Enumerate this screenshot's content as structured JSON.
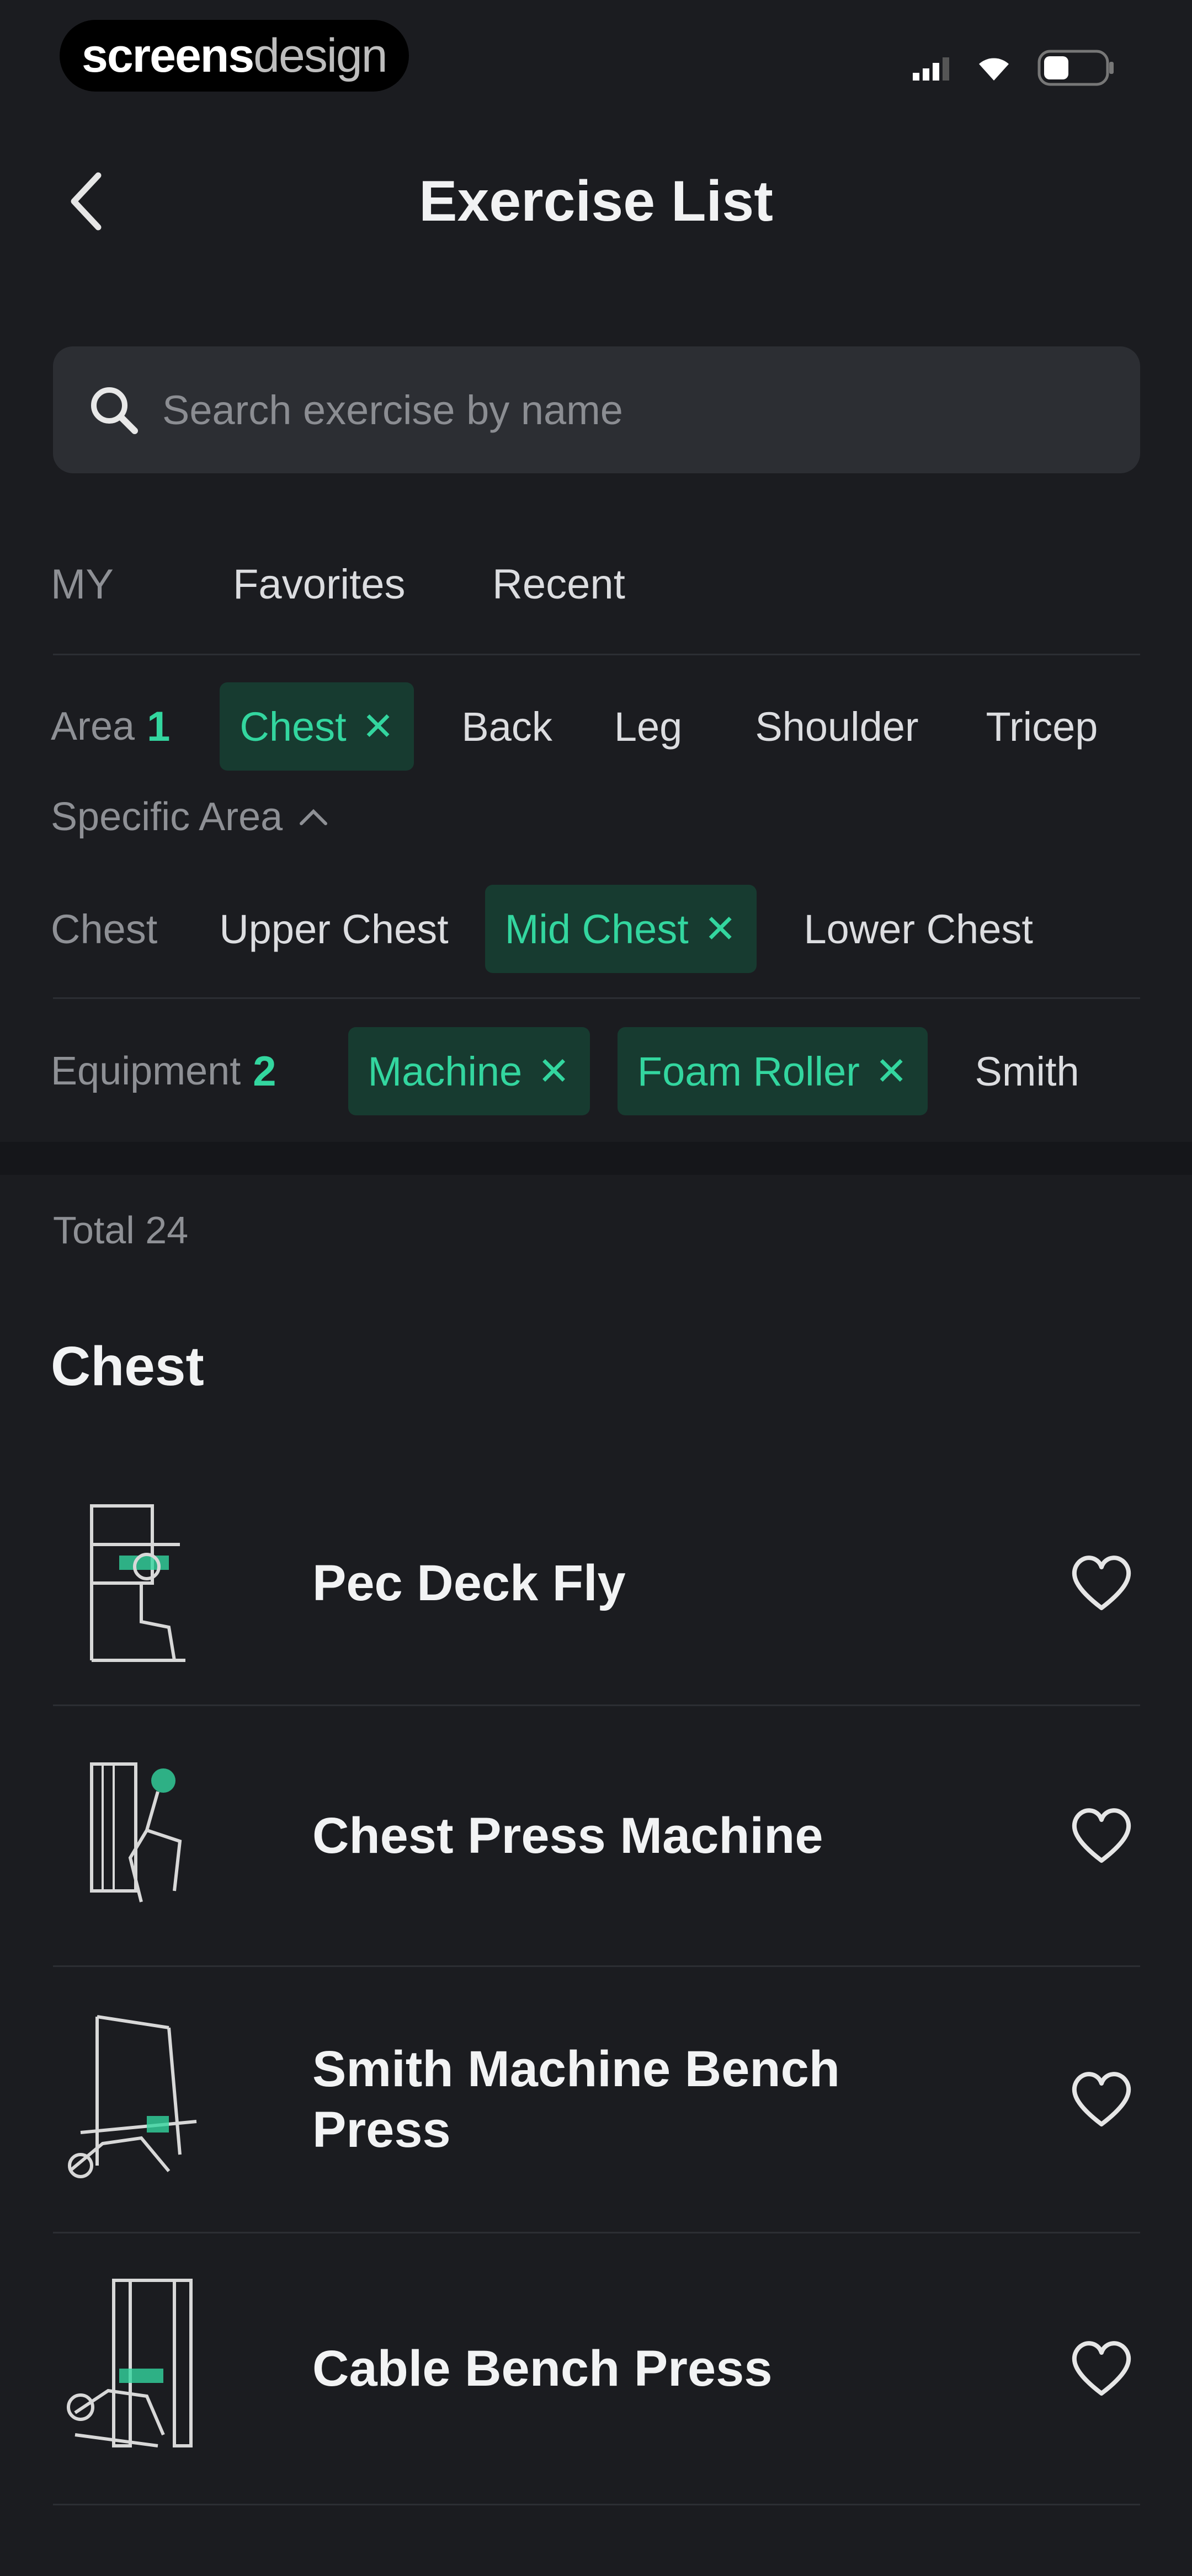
{
  "status_bar": {
    "brand_bold": "screens",
    "brand_light": "design"
  },
  "header": {
    "title": "Exercise List"
  },
  "search": {
    "placeholder": "Search exercise by name"
  },
  "tabs": [
    "MY",
    "Favorites",
    "Recent"
  ],
  "area": {
    "label": "Area",
    "count": "1",
    "chips": [
      {
        "label": "Chest",
        "selected": true
      },
      {
        "label": "Back",
        "selected": false
      },
      {
        "label": "Leg",
        "selected": false
      },
      {
        "label": "Shoulder",
        "selected": false
      },
      {
        "label": "Tricep",
        "selected": false
      }
    ]
  },
  "specific_area": {
    "label": "Specific Area",
    "chips": [
      {
        "label": "Chest",
        "selected": false
      },
      {
        "label": "Upper Chest",
        "selected": false
      },
      {
        "label": "Mid Chest",
        "selected": true
      },
      {
        "label": "Lower Chest",
        "selected": false
      }
    ]
  },
  "equipment": {
    "label": "Equipment",
    "count": "2",
    "chips": [
      {
        "label": "Machine",
        "selected": true
      },
      {
        "label": "Foam Roller",
        "selected": true
      },
      {
        "label": "Smith",
        "selected": false
      }
    ]
  },
  "results": {
    "total_label": "Total 24",
    "section_title": "Chest"
  },
  "exercises": [
    {
      "name": "Pec Deck Fly"
    },
    {
      "name": "Chest Press Machine"
    },
    {
      "name": "Smith Machine Bench Press"
    },
    {
      "name": "Cable Bench Press"
    }
  ],
  "colors": {
    "accent": "#33d69f",
    "chip_selected_bg": "#173b30",
    "background": "#1b1c20",
    "search_bg": "#2c2e33"
  }
}
